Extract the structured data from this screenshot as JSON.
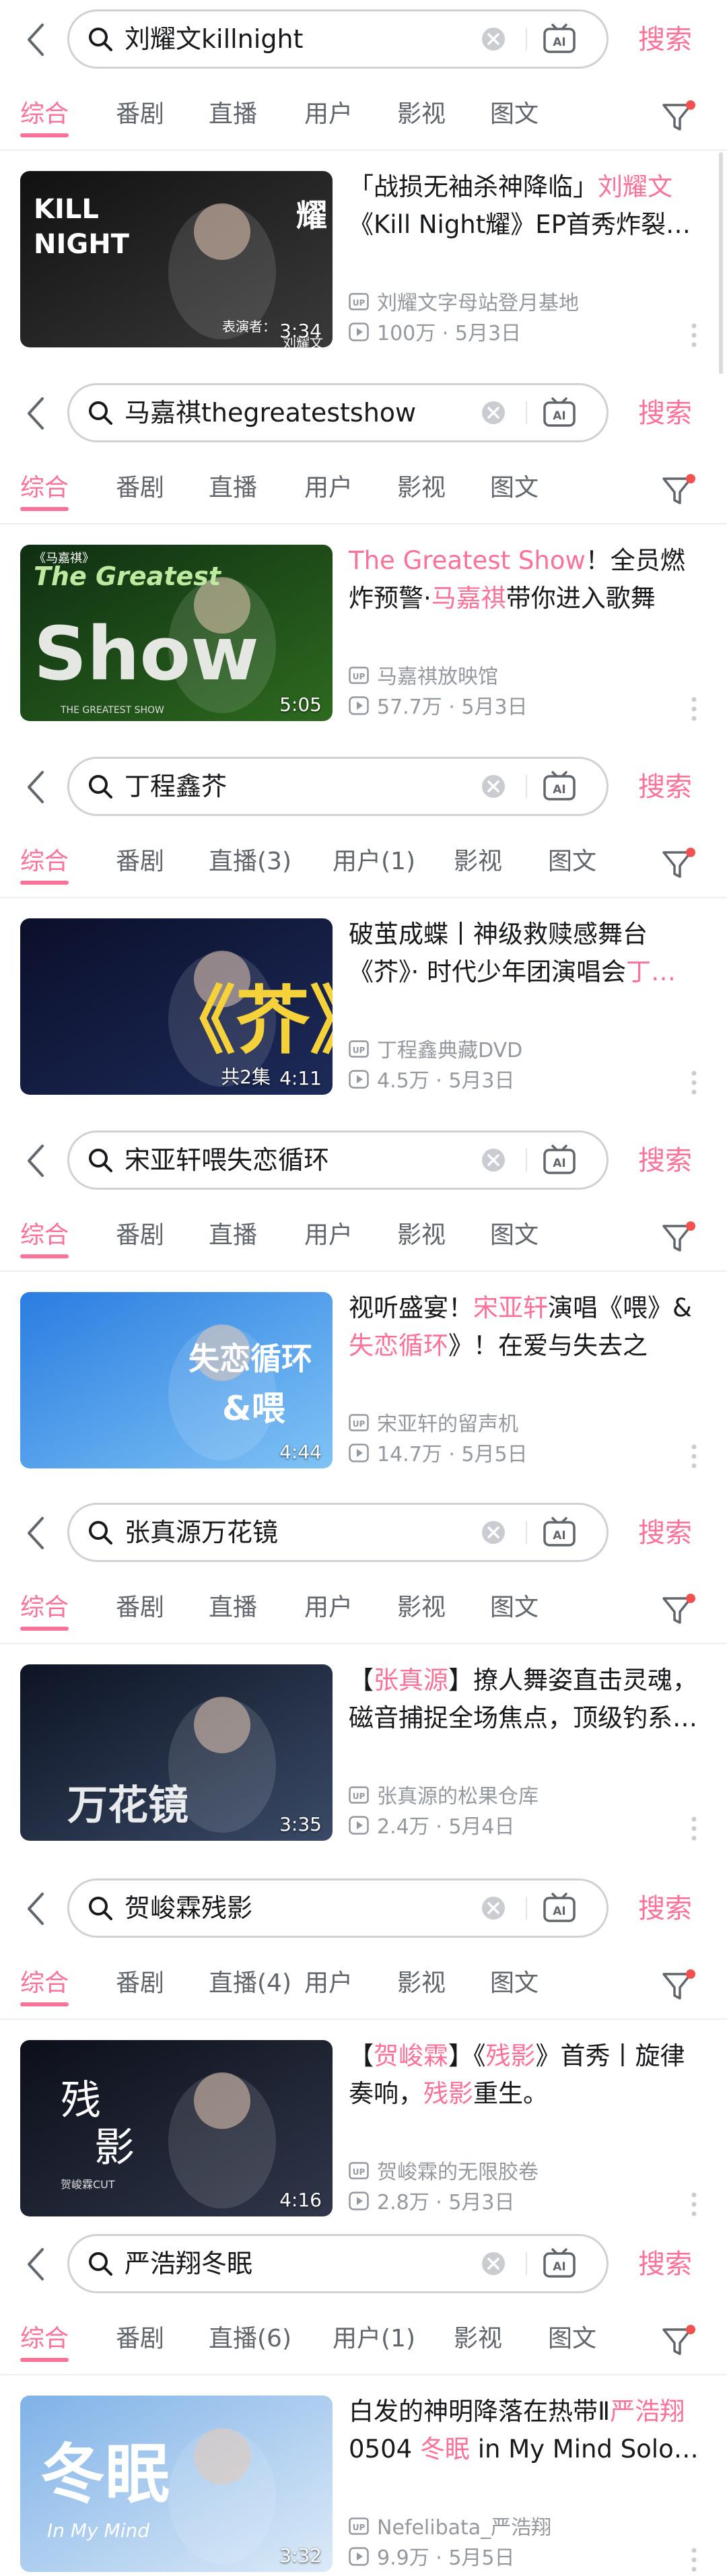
{
  "accent_color": "#fb7299",
  "search_button_label": "搜索",
  "screens": [
    {
      "query": "刘耀文killnight",
      "tabs": [
        "综合",
        "番剧",
        "直播",
        "用户",
        "影视",
        "图文"
      ],
      "thumb_text": [
        "KILL",
        "NIGHT",
        "耀",
        "表演者：",
        "刘耀文"
      ],
      "duration": "3:34",
      "episodes": "",
      "title_parts": [
        [
          "「战损无袖杀神降临」",
          false
        ],
        [
          "刘耀文",
          true
        ],
        [
          "《Kill Night耀》EP首秀炸裂…",
          false
        ]
      ],
      "uploader": "刘耀文字母站登月基地",
      "views": "100万",
      "date": "5月3日"
    },
    {
      "query": "马嘉祺thegreatestshow",
      "tabs": [
        "综合",
        "番剧",
        "直播",
        "用户",
        "影视",
        "图文"
      ],
      "thumb_text": [
        "The Greatest",
        "Show",
        "《马嘉祺》",
        "THE GREATEST SHOW"
      ],
      "duration": "5:05",
      "episodes": "",
      "title_parts": [
        [
          "The Greatest Show",
          true
        ],
        [
          "！全员燃炸预警·",
          false
        ],
        [
          "马嘉祺",
          true
        ],
        [
          "带你进入歌舞交…",
          false
        ]
      ],
      "uploader": "马嘉祺放映馆",
      "views": "57.7万",
      "date": "5月3日"
    },
    {
      "query": "丁程鑫芥",
      "tabs": [
        "综合",
        "番剧",
        "直播(3)",
        "用户(1)",
        "影视",
        "图文"
      ],
      "thumb_text": [
        "《芥》"
      ],
      "duration": "4:11",
      "episodes": "共2集",
      "title_parts": [
        [
          "破茧成蝶丨神级救赎感舞台《芥》· 时代少年团演唱会",
          false
        ],
        [
          "丁…",
          true
        ]
      ],
      "uploader": "丁程鑫典藏DVD",
      "views": "4.5万",
      "date": "5月3日"
    },
    {
      "query": "宋亚轩喂失恋循环",
      "tabs": [
        "综合",
        "番剧",
        "直播",
        "用户",
        "影视",
        "图文"
      ],
      "thumb_text": [
        "失恋循环",
        "&喂"
      ],
      "duration": "4:44",
      "episodes": "",
      "title_parts": [
        [
          "视听盛宴！",
          false
        ],
        [
          "宋亚轩",
          true
        ],
        [
          "演唱《喂》&",
          false
        ],
        [
          "失恋循环",
          true
        ],
        [
          "》！在爱与失去之间，…",
          false
        ]
      ],
      "uploader": "宋亚轩的留声机",
      "views": "14.7万",
      "date": "5月5日"
    },
    {
      "query": "张真源万花镜",
      "tabs": [
        "综合",
        "番剧",
        "直播",
        "用户",
        "影视",
        "图文"
      ],
      "thumb_text": [
        "万花镜"
      ],
      "duration": "3:35",
      "episodes": "",
      "title_parts": [
        [
          "【",
          false
        ],
        [
          "张真源",
          true
        ],
        [
          "】撩人舞姿直击灵魂，磁音捕捉全场焦点，顶级钓系…",
          false
        ]
      ],
      "uploader": "张真源的松果仓库",
      "views": "2.4万",
      "date": "5月4日"
    },
    {
      "query": "贺峻霖残影",
      "tabs": [
        "综合",
        "番剧",
        "直播(4)",
        "用户",
        "影视",
        "图文"
      ],
      "thumb_text": [
        "残",
        "影",
        "贺峻霖CUT"
      ],
      "duration": "4:16",
      "episodes": "",
      "title_parts": [
        [
          "【",
          false
        ],
        [
          "贺峻霖",
          true
        ],
        [
          "】《",
          false
        ],
        [
          "残影",
          true
        ],
        [
          "》首秀丨旋律奏响，",
          false
        ],
        [
          "残影",
          true
        ],
        [
          "重生。",
          false
        ]
      ],
      "uploader": "贺峻霖的无限胶卷",
      "views": "2.8万",
      "date": "5月3日"
    },
    {
      "query": "严浩翔冬眠",
      "tabs": [
        "综合",
        "番剧",
        "直播(6)",
        "用户(1)",
        "影视",
        "图文"
      ],
      "thumb_text": [
        "冬眠",
        "In My Mind"
      ],
      "duration": "3:32",
      "episodes": "",
      "title_parts": [
        [
          "白发的神明降落在热带Ⅱ",
          false
        ],
        [
          "严浩翔",
          true
        ],
        [
          "0504 ",
          false
        ],
        [
          "冬眠",
          true
        ],
        [
          " in My Mind Solo…",
          false
        ]
      ],
      "uploader": "Nefelibata_严浩翔",
      "views": "9.9万",
      "date": "5月5日"
    }
  ]
}
